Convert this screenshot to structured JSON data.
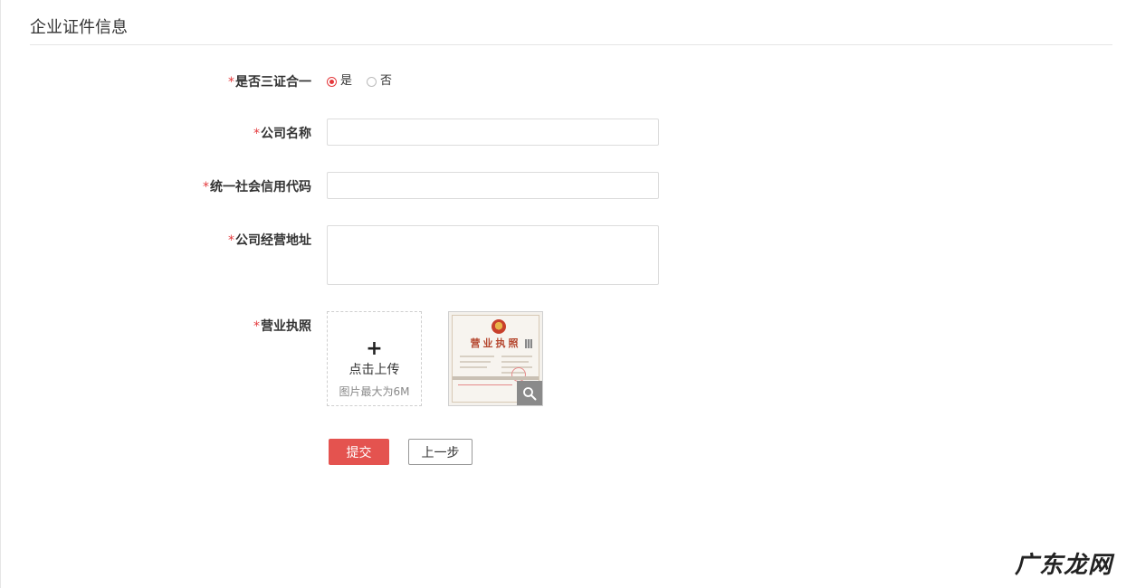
{
  "section": {
    "title": "企业证件信息"
  },
  "required_mark": "*",
  "form": {
    "three_in_one": {
      "label": "是否三证合一",
      "options": [
        {
          "label": "是",
          "checked": true
        },
        {
          "label": "否",
          "checked": false
        }
      ]
    },
    "company_name": {
      "label": "公司名称",
      "value": "",
      "placeholder": ""
    },
    "credit_code": {
      "label": "统一社会信用代码",
      "value": "",
      "placeholder": ""
    },
    "business_address": {
      "label": "公司经营地址",
      "value": "",
      "placeholder": ""
    },
    "business_license": {
      "label": "营业执照",
      "upload_plus": "+",
      "upload_text": "点击上传",
      "upload_hint": "图片最大为6M",
      "preview_title": "营业执照",
      "preview_icon": "magnifier-icon"
    }
  },
  "actions": {
    "submit_label": "提交",
    "prev_label": "上一步"
  },
  "watermark": {
    "text": "广东龙网"
  },
  "colors": {
    "accent": "#e4393c",
    "submit_bg": "#e4534f"
  }
}
